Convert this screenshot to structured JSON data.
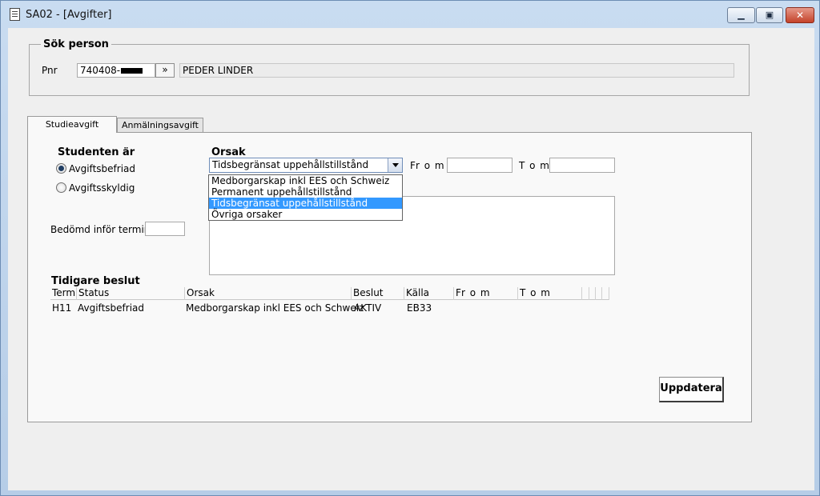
{
  "window": {
    "title": "SA02 - [Avgifter]",
    "min_glyph": "▁",
    "max_glyph": "▣",
    "close_glyph": "✕"
  },
  "search": {
    "group_title": "Sök person",
    "pnr_label": "Pnr",
    "pnr_value": "740408-",
    "go_label": "»",
    "person_name": "PEDER LINDER"
  },
  "tabs": [
    {
      "label": "Studieavgift",
      "active": true
    },
    {
      "label": "Anmälningsavgift",
      "active": false
    }
  ],
  "student": {
    "heading": "Studenten är",
    "options": [
      {
        "label": "Avgiftsbefriad",
        "checked": true
      },
      {
        "label": "Avgiftsskyldig",
        "checked": false
      }
    ],
    "term_label": "Bedömd inför termin",
    "term_value": ""
  },
  "reason": {
    "heading": "Orsak",
    "selected": "Tidsbegränsat uppehållstillstånd",
    "options": [
      "Medborgarskap inkl EES och Schweiz",
      "Permanent uppehållstillstånd",
      "Tidsbegränsat uppehållstillstånd",
      "Övriga orsaker"
    ],
    "from_label": "Fr o m",
    "from_value": "",
    "to_label": "T o m",
    "to_value": ""
  },
  "history": {
    "heading": "Tidigare beslut",
    "columns": [
      "Termi",
      "Status",
      "Orsak",
      "Beslut",
      "Källa",
      "Fr o m",
      "T o m"
    ],
    "rows": [
      [
        "H11",
        "Avgiftsbefriad",
        "Medborgarskap inkl EES och Schweiz",
        "AKTIV",
        "EB33",
        "",
        ""
      ]
    ]
  },
  "actions": {
    "update_label": "Uppdatera"
  }
}
